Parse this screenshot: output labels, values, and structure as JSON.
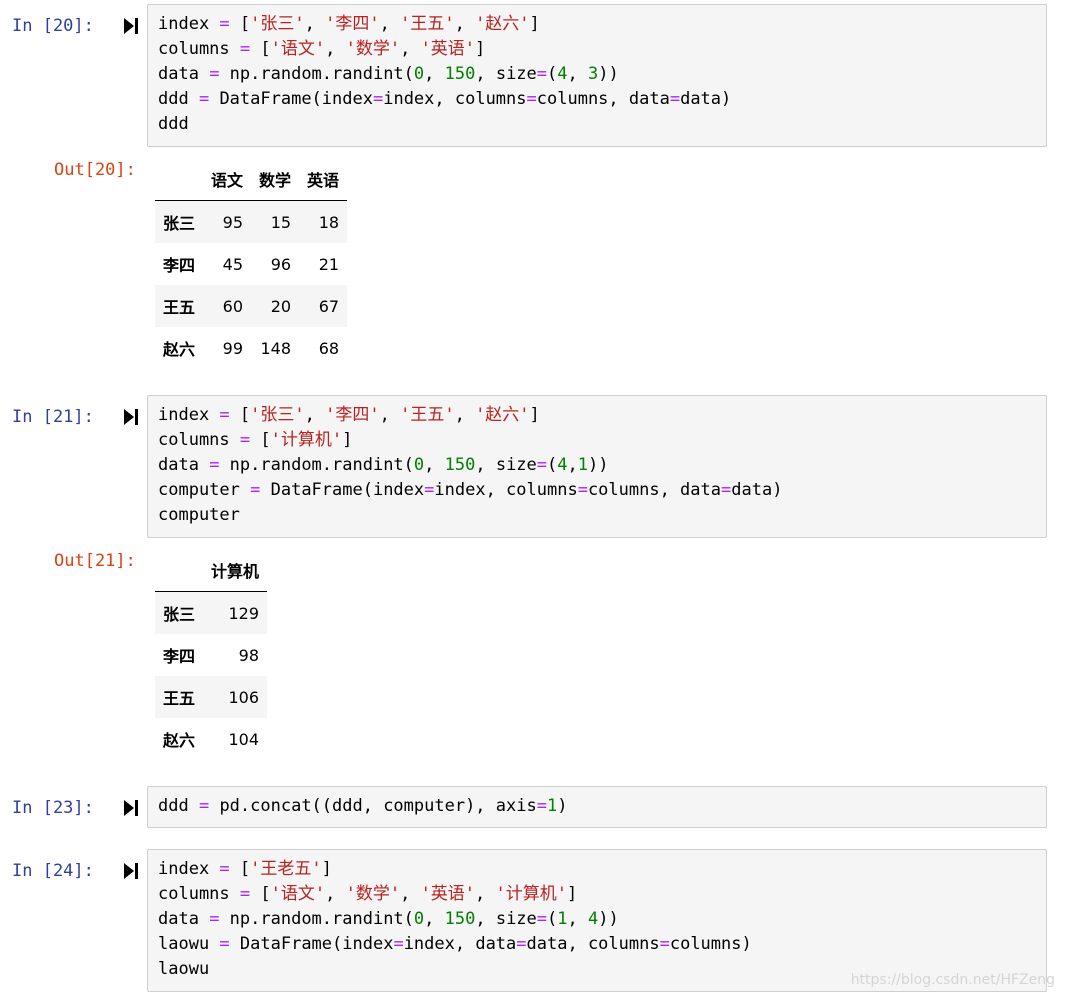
{
  "cells": [
    {
      "in_prompt": "In [20]:",
      "code": [
        [
          {
            "t": "index "
          },
          {
            "t": "=",
            "c": "op"
          },
          {
            "t": " ["
          },
          {
            "t": "'张三'",
            "c": "str"
          },
          {
            "t": ", "
          },
          {
            "t": "'李四'",
            "c": "str"
          },
          {
            "t": ", "
          },
          {
            "t": "'王五'",
            "c": "str"
          },
          {
            "t": ", "
          },
          {
            "t": "'赵六'",
            "c": "str"
          },
          {
            "t": "]"
          }
        ],
        [
          {
            "t": "columns "
          },
          {
            "t": "=",
            "c": "op"
          },
          {
            "t": " ["
          },
          {
            "t": "'语文'",
            "c": "str"
          },
          {
            "t": ", "
          },
          {
            "t": "'数学'",
            "c": "str"
          },
          {
            "t": ", "
          },
          {
            "t": "'英语'",
            "c": "str"
          },
          {
            "t": "]"
          }
        ],
        [
          {
            "t": "data "
          },
          {
            "t": "=",
            "c": "op"
          },
          {
            "t": " np.random.randint("
          },
          {
            "t": "0",
            "c": "num"
          },
          {
            "t": ", "
          },
          {
            "t": "150",
            "c": "num"
          },
          {
            "t": ", size"
          },
          {
            "t": "=",
            "c": "op"
          },
          {
            "t": "("
          },
          {
            "t": "4",
            "c": "num"
          },
          {
            "t": ", "
          },
          {
            "t": "3",
            "c": "num"
          },
          {
            "t": "))"
          }
        ],
        [
          {
            "t": "ddd "
          },
          {
            "t": "=",
            "c": "op"
          },
          {
            "t": " DataFrame(index"
          },
          {
            "t": "=",
            "c": "op"
          },
          {
            "t": "index, columns"
          },
          {
            "t": "=",
            "c": "op"
          },
          {
            "t": "columns, data"
          },
          {
            "t": "=",
            "c": "op"
          },
          {
            "t": "data)"
          }
        ],
        [
          {
            "t": "ddd"
          }
        ]
      ],
      "out_prompt": "Out[20]:",
      "output_table": {
        "columns": [
          "语文",
          "数学",
          "英语"
        ],
        "rows": [
          {
            "index": "张三",
            "values": [
              "95",
              "15",
              "18"
            ]
          },
          {
            "index": "李四",
            "values": [
              "45",
              "96",
              "21"
            ]
          },
          {
            "index": "王五",
            "values": [
              "60",
              "20",
              "67"
            ]
          },
          {
            "index": "赵六",
            "values": [
              "99",
              "148",
              "68"
            ]
          }
        ]
      }
    },
    {
      "in_prompt": "In [21]:",
      "code": [
        [
          {
            "t": "index "
          },
          {
            "t": "=",
            "c": "op"
          },
          {
            "t": " ["
          },
          {
            "t": "'张三'",
            "c": "str"
          },
          {
            "t": ", "
          },
          {
            "t": "'李四'",
            "c": "str"
          },
          {
            "t": ", "
          },
          {
            "t": "'王五'",
            "c": "str"
          },
          {
            "t": ", "
          },
          {
            "t": "'赵六'",
            "c": "str"
          },
          {
            "t": "]"
          }
        ],
        [
          {
            "t": "columns "
          },
          {
            "t": "=",
            "c": "op"
          },
          {
            "t": " ["
          },
          {
            "t": "'计算机'",
            "c": "str"
          },
          {
            "t": "]"
          }
        ],
        [
          {
            "t": "data "
          },
          {
            "t": "=",
            "c": "op"
          },
          {
            "t": " np.random.randint("
          },
          {
            "t": "0",
            "c": "num"
          },
          {
            "t": ", "
          },
          {
            "t": "150",
            "c": "num"
          },
          {
            "t": ", size"
          },
          {
            "t": "=",
            "c": "op"
          },
          {
            "t": "("
          },
          {
            "t": "4",
            "c": "num"
          },
          {
            "t": ","
          },
          {
            "t": "1",
            "c": "num"
          },
          {
            "t": "))"
          }
        ],
        [
          {
            "t": "computer "
          },
          {
            "t": "=",
            "c": "op"
          },
          {
            "t": " DataFrame(index"
          },
          {
            "t": "=",
            "c": "op"
          },
          {
            "t": "index, columns"
          },
          {
            "t": "=",
            "c": "op"
          },
          {
            "t": "columns, data"
          },
          {
            "t": "=",
            "c": "op"
          },
          {
            "t": "data)"
          }
        ],
        [
          {
            "t": "computer"
          }
        ]
      ],
      "out_prompt": "Out[21]:",
      "output_table": {
        "columns": [
          "计算机"
        ],
        "rows": [
          {
            "index": "张三",
            "values": [
              "129"
            ]
          },
          {
            "index": "李四",
            "values": [
              "98"
            ]
          },
          {
            "index": "王五",
            "values": [
              "106"
            ]
          },
          {
            "index": "赵六",
            "values": [
              "104"
            ]
          }
        ]
      }
    },
    {
      "in_prompt": "In [23]:",
      "code": [
        [
          {
            "t": "ddd "
          },
          {
            "t": "=",
            "c": "op"
          },
          {
            "t": " pd.concat((ddd, computer), axis"
          },
          {
            "t": "=",
            "c": "op"
          },
          {
            "t": "1",
            "c": "num"
          },
          {
            "t": ")"
          }
        ]
      ]
    },
    {
      "in_prompt": "In [24]:",
      "code": [
        [
          {
            "t": "index "
          },
          {
            "t": "=",
            "c": "op"
          },
          {
            "t": " ["
          },
          {
            "t": "'王老五'",
            "c": "str"
          },
          {
            "t": "]"
          }
        ],
        [
          {
            "t": "columns "
          },
          {
            "t": "=",
            "c": "op"
          },
          {
            "t": " ["
          },
          {
            "t": "'语文'",
            "c": "str"
          },
          {
            "t": ", "
          },
          {
            "t": "'数学'",
            "c": "str"
          },
          {
            "t": ", "
          },
          {
            "t": "'英语'",
            "c": "str"
          },
          {
            "t": ", "
          },
          {
            "t": "'计算机'",
            "c": "str"
          },
          {
            "t": "]"
          }
        ],
        [
          {
            "t": "data "
          },
          {
            "t": "=",
            "c": "op"
          },
          {
            "t": " np.random.randint("
          },
          {
            "t": "0",
            "c": "num"
          },
          {
            "t": ", "
          },
          {
            "t": "150",
            "c": "num"
          },
          {
            "t": ", size"
          },
          {
            "t": "=",
            "c": "op"
          },
          {
            "t": "("
          },
          {
            "t": "1",
            "c": "num"
          },
          {
            "t": ", "
          },
          {
            "t": "4",
            "c": "num"
          },
          {
            "t": "))"
          }
        ],
        [
          {
            "t": "laowu "
          },
          {
            "t": "=",
            "c": "op"
          },
          {
            "t": " DataFrame(index"
          },
          {
            "t": "=",
            "c": "op"
          },
          {
            "t": "index, data"
          },
          {
            "t": "=",
            "c": "op"
          },
          {
            "t": "data, columns"
          },
          {
            "t": "=",
            "c": "op"
          },
          {
            "t": "columns)"
          }
        ],
        [
          {
            "t": "laowu"
          }
        ]
      ]
    }
  ],
  "run_icon": "run-cell-icon",
  "colors": {
    "in_prompt": "#303f9f",
    "out_prompt": "#d84315",
    "operator": "#aa22ff",
    "string": "#ba2121",
    "number": "#008000",
    "cell_background": "#f5f5f5"
  },
  "watermark": "https://blog.csdn.net/HFZeng"
}
